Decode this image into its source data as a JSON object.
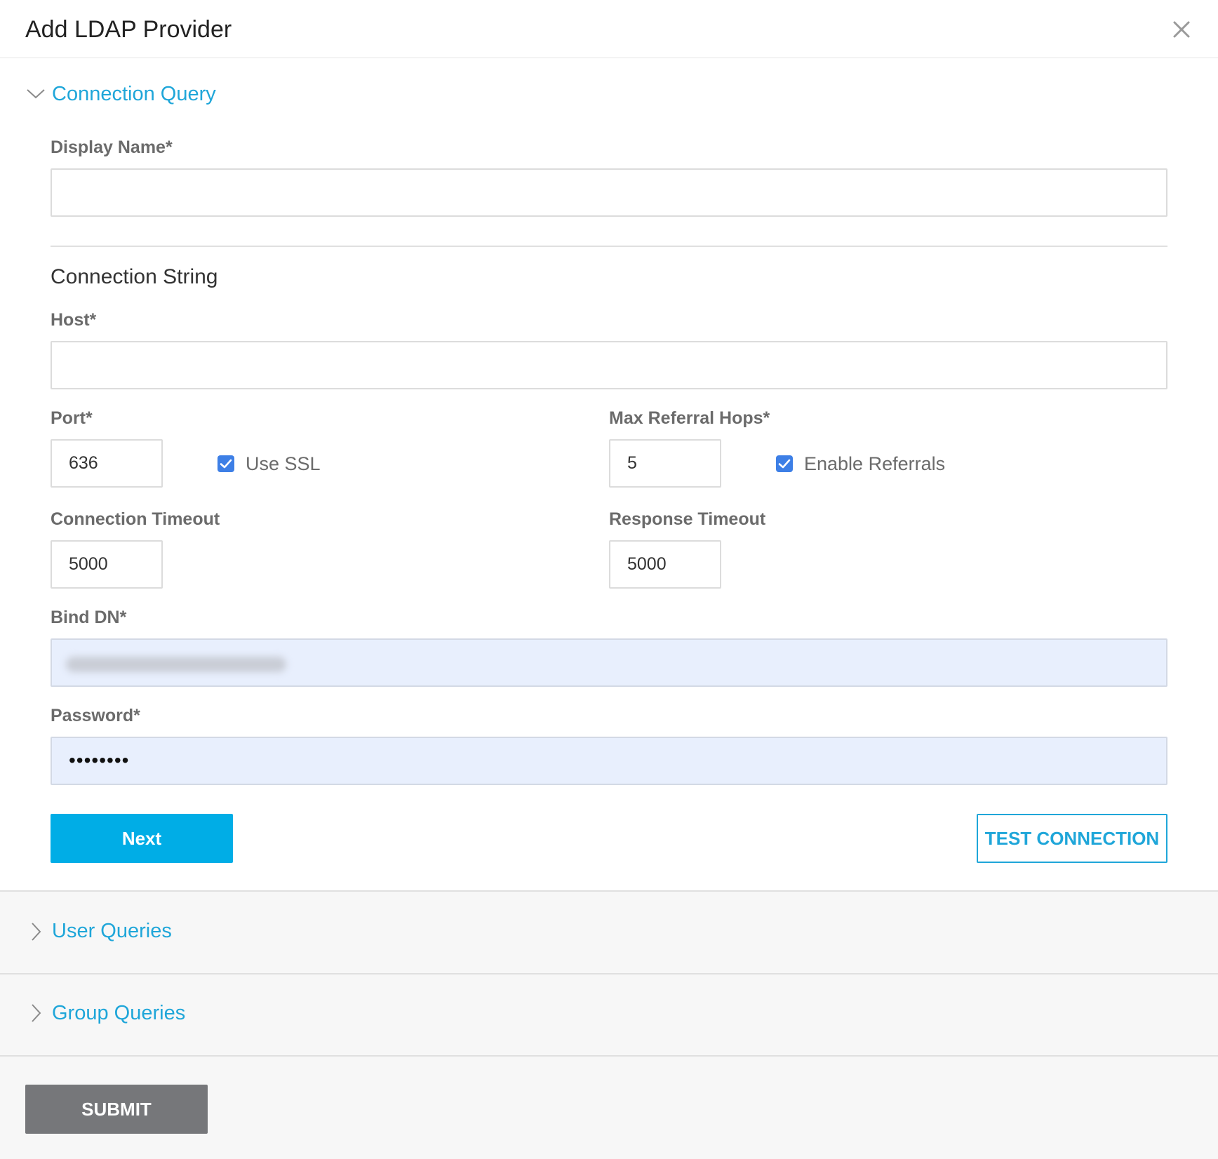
{
  "dialog": {
    "title": "Add LDAP Provider",
    "close_icon": "close-icon"
  },
  "connection_query": {
    "title": "Connection Query",
    "expanded": true,
    "display_name": {
      "label": "Display Name*",
      "value": ""
    },
    "connection_string_heading": "Connection String",
    "host": {
      "label": "Host*",
      "value": ""
    },
    "port": {
      "label": "Port*",
      "value": "636"
    },
    "use_ssl": {
      "label": "Use SSL",
      "checked": true
    },
    "max_referral_hops": {
      "label": "Max Referral Hops*",
      "value": "5"
    },
    "enable_referrals": {
      "label": "Enable Referrals",
      "checked": true
    },
    "connection_timeout": {
      "label": "Connection Timeout",
      "value": "5000"
    },
    "response_timeout": {
      "label": "Response Timeout",
      "value": "5000"
    },
    "bind_dn": {
      "label": "Bind DN*",
      "value_obscured": true
    },
    "password": {
      "label": "Password*",
      "value": "••••••••"
    },
    "next_label": "Next",
    "test_connection_label": "TEST CONNECTION"
  },
  "user_queries": {
    "title": "User Queries",
    "expanded": false
  },
  "group_queries": {
    "title": "Group Queries",
    "expanded": false
  },
  "footer": {
    "submit_label": "SUBMIT"
  },
  "colors": {
    "accent": "#1fa6d9",
    "primary_button": "#00ade6",
    "checkbox": "#3d7fe6",
    "submit_button": "#76777a",
    "autofill_bg": "#e8effd"
  }
}
